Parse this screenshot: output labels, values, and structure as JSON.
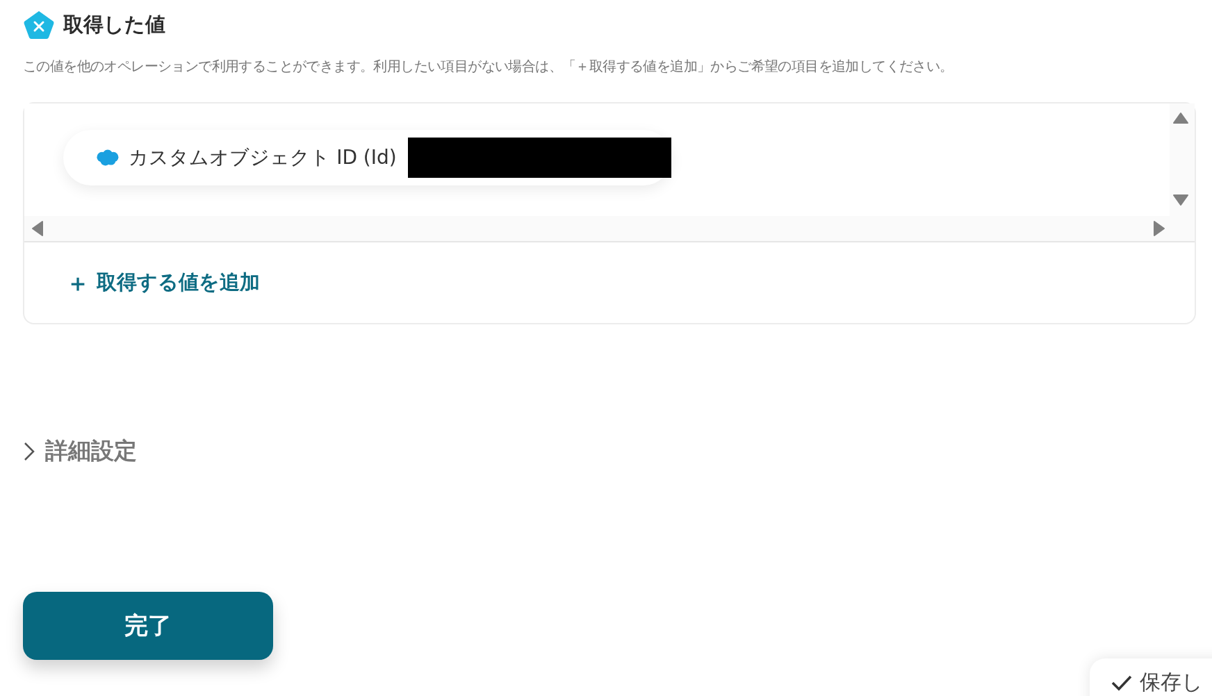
{
  "section": {
    "title": "取得した値",
    "description": "この値を他のオペレーションで利用することができます。利用したい項目がない場合は、「＋取得する値を追加」からご希望の項目を追加してください。"
  },
  "values": [
    {
      "label": "カスタムオブジェクト ID (Id)",
      "redacted": true
    }
  ],
  "add_button": {
    "icon": "＋",
    "label": "取得する値を追加"
  },
  "details": {
    "label": "詳細設定",
    "expanded": false
  },
  "done_button": "完了",
  "toast": {
    "label": "保存し"
  }
}
